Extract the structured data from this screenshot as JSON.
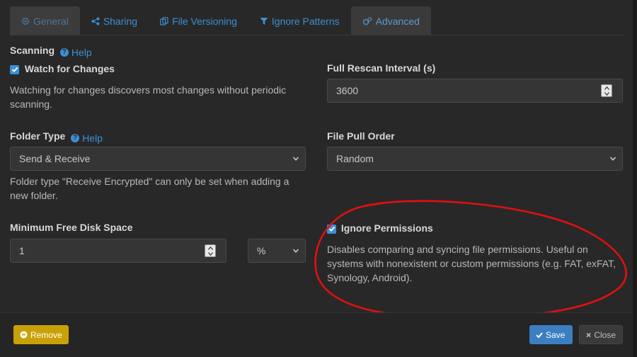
{
  "tabs": [
    {
      "label": "General",
      "icon": "gear-icon"
    },
    {
      "label": "Sharing",
      "icon": "share-icon"
    },
    {
      "label": "File Versioning",
      "icon": "copy-icon"
    },
    {
      "label": "Ignore Patterns",
      "icon": "filter-icon"
    },
    {
      "label": "Advanced",
      "icon": "gears-icon"
    }
  ],
  "scanning": {
    "title": "Scanning",
    "help": "Help",
    "watch_label": "Watch for Changes",
    "watch_checked": true,
    "watch_help": "Watching for changes discovers most changes without periodic scanning."
  },
  "rescan": {
    "label": "Full Rescan Interval (s)",
    "value": "3600"
  },
  "folder_type": {
    "label": "Folder Type",
    "help": "Help",
    "value": "Send & Receive",
    "note": "Folder type \"Receive Encrypted\" can only be set when adding a new folder."
  },
  "pull_order": {
    "label": "File Pull Order",
    "value": "Random"
  },
  "min_disk": {
    "label": "Minimum Free Disk Space",
    "value": "1",
    "unit": "%"
  },
  "ignore_perms": {
    "label": "Ignore Permissions",
    "checked": true,
    "help": "Disables comparing and syncing file permissions. Useful on systems with nonexistent or custom permissions (e.g. FAT, exFAT, Synology, Android)."
  },
  "footer": {
    "remove": "Remove",
    "save": "Save",
    "close": "Close"
  },
  "colors": {
    "accent": "#3c8fd4",
    "warning": "#c9a006",
    "primary": "#3c7fc0",
    "annotation": "#e01010"
  }
}
